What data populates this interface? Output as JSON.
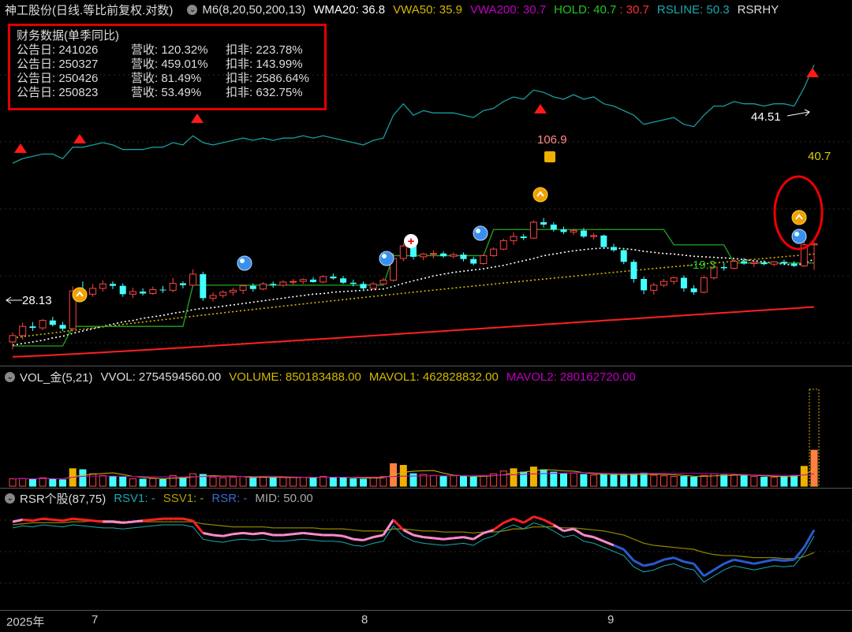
{
  "header_main": {
    "title": "神工股份(日线.等比前复权.对数)",
    "ma": "M6(8,20,50,200,13)",
    "wma20": "WMA20: 36.8",
    "vwa50": "VWA50: 35.9",
    "vwa200": "VWA200: 30.7",
    "hold": "HOLD: 40.7",
    "hold2": ": 30.7",
    "rsline": "RSLINE: 50.3",
    "rsrh": "RSRHY"
  },
  "header_vol": {
    "name": "VOL_金(5,21)",
    "vvol": "VVOL: 2754594560.00",
    "volume": "VOLUME: 850183488.00",
    "mavol1": "MAVOL1: 462828832.00",
    "mavol2": "MAVOL2: 280162720.00"
  },
  "header_rsr": {
    "name": "RSR个股(87,75)",
    "rsv1": "RSV1: -",
    "ssv1": "SSV1: -",
    "rsr": "RSR: -",
    "mid": "MID: 50.00"
  },
  "fin_box": {
    "title": "财务数据(单季同比)",
    "rows": [
      {
        "date": "公告日: 241026",
        "rev": "营收: 120.32%",
        "np": "扣非: 223.78%"
      },
      {
        "date": "公告日: 250327",
        "rev": "营收: 459.01%",
        "np": "扣非: 143.99%"
      },
      {
        "date": "公告日: 250426",
        "rev": "营收: 81.49%",
        "np": "扣非: 2586.64%"
      },
      {
        "date": "公告日: 250823",
        "rev": "营收: 53.49%",
        "np": "扣非: 632.75%"
      }
    ]
  },
  "annotations": {
    "low_start": "28.13",
    "high": "106.9",
    "low": "-19.3",
    "last_high": "44.51",
    "last": "40.7"
  },
  "x_axis": [
    "2025年",
    "7",
    "8",
    "9"
  ],
  "colors": {
    "up": "#ff4444",
    "down": "#44ffff",
    "rsline": "#1a9ba0",
    "wma": "#ffffff",
    "vwa50": "#d4b800",
    "vwa200": "#ff2020",
    "hold": "#1fa81f"
  },
  "chart_data": {
    "type": "candlestick",
    "ylim": [
      27,
      110
    ],
    "candles": [
      [
        29.0,
        30.2,
        28.1,
        29.8
      ],
      [
        29.8,
        31.5,
        29.3,
        31.0
      ],
      [
        31.0,
        31.6,
        30.4,
        30.8
      ],
      [
        30.8,
        32.0,
        30.5,
        31.8
      ],
      [
        31.8,
        32.3,
        31.0,
        31.2
      ],
      [
        31.2,
        31.6,
        30.4,
        30.7
      ],
      [
        30.7,
        36.8,
        30.5,
        36.1
      ],
      [
        36.1,
        37.6,
        35.2,
        35.6
      ],
      [
        35.6,
        37.2,
        35.2,
        36.5
      ],
      [
        36.5,
        37.8,
        36.0,
        37.2
      ],
      [
        37.2,
        37.6,
        36.4,
        36.9
      ],
      [
        36.9,
        37.3,
        35.2,
        35.6
      ],
      [
        35.6,
        36.6,
        35.0,
        36.0
      ],
      [
        36.0,
        36.5,
        35.4,
        35.7
      ],
      [
        35.7,
        36.8,
        35.5,
        36.3
      ],
      [
        36.3,
        36.9,
        35.8,
        36.2
      ],
      [
        36.2,
        38.2,
        35.9,
        37.3
      ],
      [
        37.3,
        37.6,
        36.5,
        37.0
      ],
      [
        37.0,
        39.6,
        36.8,
        38.8
      ],
      [
        38.8,
        39.2,
        34.6,
        35.0
      ],
      [
        35.0,
        35.9,
        34.5,
        35.4
      ],
      [
        35.4,
        36.2,
        35.0,
        35.9
      ],
      [
        35.9,
        36.6,
        35.4,
        36.2
      ],
      [
        36.2,
        37.1,
        35.6,
        36.9
      ],
      [
        36.9,
        37.3,
        36.0,
        36.4
      ],
      [
        36.4,
        37.5,
        36.2,
        37.2
      ],
      [
        37.2,
        37.6,
        36.6,
        37.0
      ],
      [
        37.0,
        37.8,
        36.7,
        37.5
      ],
      [
        37.5,
        38.0,
        37.0,
        37.6
      ],
      [
        37.6,
        38.1,
        37.2,
        37.9
      ],
      [
        37.9,
        38.3,
        37.4,
        37.5
      ],
      [
        37.5,
        38.6,
        37.3,
        38.4
      ],
      [
        38.4,
        38.9,
        37.9,
        38.1
      ],
      [
        38.1,
        38.5,
        37.2,
        37.4
      ],
      [
        37.4,
        37.9,
        36.8,
        37.2
      ],
      [
        37.2,
        37.6,
        36.1,
        36.5
      ],
      [
        36.5,
        37.5,
        36.3,
        37.2
      ],
      [
        37.2,
        38.2,
        37.0,
        37.8
      ],
      [
        37.8,
        42.5,
        37.6,
        41.5
      ],
      [
        41.5,
        44.3,
        41.0,
        43.8
      ],
      [
        43.8,
        44.2,
        41.3,
        41.8
      ],
      [
        41.8,
        42.5,
        41.2,
        42.3
      ],
      [
        42.3,
        43.0,
        41.5,
        42.4
      ],
      [
        42.4,
        42.8,
        41.6,
        41.9
      ],
      [
        41.9,
        42.6,
        41.5,
        42.2
      ],
      [
        42.2,
        42.6,
        41.0,
        41.4
      ],
      [
        41.4,
        41.8,
        40.3,
        40.6
      ],
      [
        40.6,
        42.3,
        40.4,
        42.0
      ],
      [
        42.0,
        43.5,
        41.8,
        43.2
      ],
      [
        43.2,
        45.2,
        43.0,
        44.8
      ],
      [
        44.8,
        46.4,
        44.0,
        45.6
      ],
      [
        45.6,
        46.1,
        44.9,
        45.3
      ],
      [
        45.3,
        48.9,
        45.1,
        48.5
      ],
      [
        48.5,
        49.4,
        47.4,
        48.0
      ],
      [
        48.0,
        48.5,
        46.6,
        47.0
      ],
      [
        47.0,
        47.6,
        46.1,
        46.5
      ],
      [
        46.5,
        47.2,
        45.9,
        46.8
      ],
      [
        46.8,
        47.3,
        45.3,
        45.6
      ],
      [
        45.6,
        46.3,
        45.0,
        45.8
      ],
      [
        45.8,
        46.0,
        43.2,
        43.6
      ],
      [
        43.6,
        44.2,
        42.7,
        43.0
      ],
      [
        43.0,
        43.4,
        40.5,
        40.9
      ],
      [
        40.9,
        41.3,
        37.4,
        38.0
      ],
      [
        38.0,
        38.4,
        35.6,
        36.2
      ],
      [
        36.2,
        37.4,
        35.5,
        37.0
      ],
      [
        37.0,
        38.0,
        36.7,
        37.6
      ],
      [
        37.6,
        38.4,
        37.1,
        38.2
      ],
      [
        38.2,
        38.6,
        36.0,
        36.5
      ],
      [
        36.5,
        37.0,
        35.5,
        35.9
      ],
      [
        35.9,
        38.6,
        35.7,
        38.2
      ],
      [
        38.2,
        40.3,
        37.9,
        40.0
      ],
      [
        40.0,
        40.7,
        39.4,
        39.8
      ],
      [
        39.8,
        41.4,
        39.6,
        41.0
      ],
      [
        41.0,
        41.6,
        40.4,
        40.6
      ],
      [
        40.6,
        41.1,
        40.0,
        40.8
      ],
      [
        40.8,
        41.2,
        40.3,
        40.5
      ],
      [
        40.5,
        41.0,
        40.1,
        40.9
      ],
      [
        40.9,
        41.3,
        40.3,
        40.6
      ],
      [
        40.6,
        41.0,
        40.0,
        40.2
      ],
      [
        40.2,
        44.5,
        40.0,
        44.0
      ],
      [
        44.0,
        44.51,
        39.5,
        44.2
      ]
    ],
    "wma20": [
      28.6,
      28.8,
      29.0,
      29.2,
      29.5,
      29.7,
      30.1,
      30.4,
      30.7,
      31.0,
      31.3,
      31.6,
      31.8,
      32.1,
      32.3,
      32.5,
      32.8,
      33.0,
      33.3,
      33.5,
      33.6,
      33.8,
      34.0,
      34.2,
      34.4,
      34.6,
      34.8,
      35.0,
      35.2,
      35.4,
      35.6,
      35.7,
      35.9,
      36.0,
      36.1,
      36.2,
      36.3,
      36.4,
      36.8,
      37.3,
      37.7,
      38.1,
      38.5,
      38.8,
      39.1,
      39.3,
      39.5,
      39.7,
      40.0,
      40.3,
      40.7,
      41.1,
      41.5,
      42.0,
      42.3,
      42.6,
      42.9,
      43.1,
      43.3,
      43.4,
      43.4,
      43.3,
      43.1,
      42.8,
      42.6,
      42.4,
      42.3,
      42.1,
      41.9,
      41.8,
      41.7,
      41.6,
      41.5,
      41.3,
      41.1,
      40.9,
      40.7,
      40.5,
      40.3,
      40.6,
      41.4
    ],
    "rsline": [
      59,
      61,
      62,
      63,
      63,
      61,
      66,
      66,
      67,
      68,
      67,
      65,
      65,
      65,
      66,
      66,
      68,
      67,
      71,
      68,
      67,
      68,
      69,
      70,
      69,
      70,
      69,
      70,
      70,
      71,
      70,
      71,
      70,
      69,
      68,
      67,
      69,
      70,
      80,
      85,
      80,
      82,
      81,
      81,
      81,
      80,
      79,
      82,
      83,
      86,
      88,
      87,
      91,
      90,
      88,
      87,
      89,
      87,
      88,
      85,
      84,
      82,
      80,
      76,
      77,
      78,
      79,
      76,
      75,
      80,
      84,
      84,
      86,
      85,
      85,
      84,
      85,
      85,
      84,
      92,
      102
    ]
  },
  "volume_data": {
    "values": [
      0.15,
      0.16,
      0.14,
      0.18,
      0.15,
      0.12,
      0.45,
      0.42,
      0.3,
      0.25,
      0.22,
      0.2,
      0.15,
      0.14,
      0.16,
      0.13,
      0.25,
      0.18,
      0.3,
      0.28,
      0.2,
      0.18,
      0.2,
      0.22,
      0.17,
      0.2,
      0.18,
      0.19,
      0.2,
      0.2,
      0.18,
      0.22,
      0.2,
      0.18,
      0.15,
      0.14,
      0.2,
      0.22,
      0.6,
      0.55,
      0.3,
      0.28,
      0.25,
      0.22,
      0.24,
      0.22,
      0.2,
      0.25,
      0.3,
      0.38,
      0.45,
      0.35,
      0.5,
      0.42,
      0.35,
      0.3,
      0.32,
      0.28,
      0.26,
      0.28,
      0.26,
      0.28,
      0.3,
      0.32,
      0.26,
      0.24,
      0.22,
      0.22,
      0.2,
      0.25,
      0.3,
      0.26,
      0.28,
      0.24,
      0.22,
      0.2,
      0.2,
      0.22,
      0.25,
      0.52,
      1.0
    ]
  },
  "rsr_data": {
    "rsv1": [
      83,
      85,
      84,
      86,
      85,
      84,
      86,
      85,
      84,
      83,
      83,
      82,
      83,
      84,
      85,
      86,
      86,
      86,
      84,
      72,
      70,
      69,
      71,
      72,
      71,
      72,
      70,
      70,
      71,
      72,
      71,
      70,
      70,
      69,
      66,
      65,
      68,
      70,
      85,
      75,
      70,
      68,
      67,
      66,
      67,
      68,
      66,
      72,
      75,
      82,
      86,
      82,
      88,
      85,
      80,
      74,
      76,
      70,
      68,
      64,
      60,
      56,
      45,
      40,
      42,
      46,
      48,
      44,
      42,
      30,
      36,
      42,
      46,
      44,
      42,
      44,
      46,
      45,
      46,
      58,
      75
    ],
    "ssv1": [
      80,
      81,
      82,
      82,
      82,
      82,
      83,
      83,
      84,
      84,
      84,
      83,
      83,
      83,
      83,
      83,
      83,
      83,
      83,
      81,
      80,
      79,
      78,
      78,
      78,
      78,
      77,
      77,
      77,
      77,
      77,
      76,
      76,
      76,
      75,
      74,
      74,
      74,
      76,
      76,
      75,
      74,
      74,
      73,
      73,
      73,
      72,
      73,
      73,
      74,
      76,
      76,
      78,
      78,
      78,
      77,
      77,
      76,
      75,
      74,
      72,
      70,
      66,
      62,
      60,
      59,
      58,
      57,
      56,
      53,
      51,
      50,
      50,
      49,
      48,
      48,
      48,
      47,
      47,
      49,
      53
    ]
  }
}
